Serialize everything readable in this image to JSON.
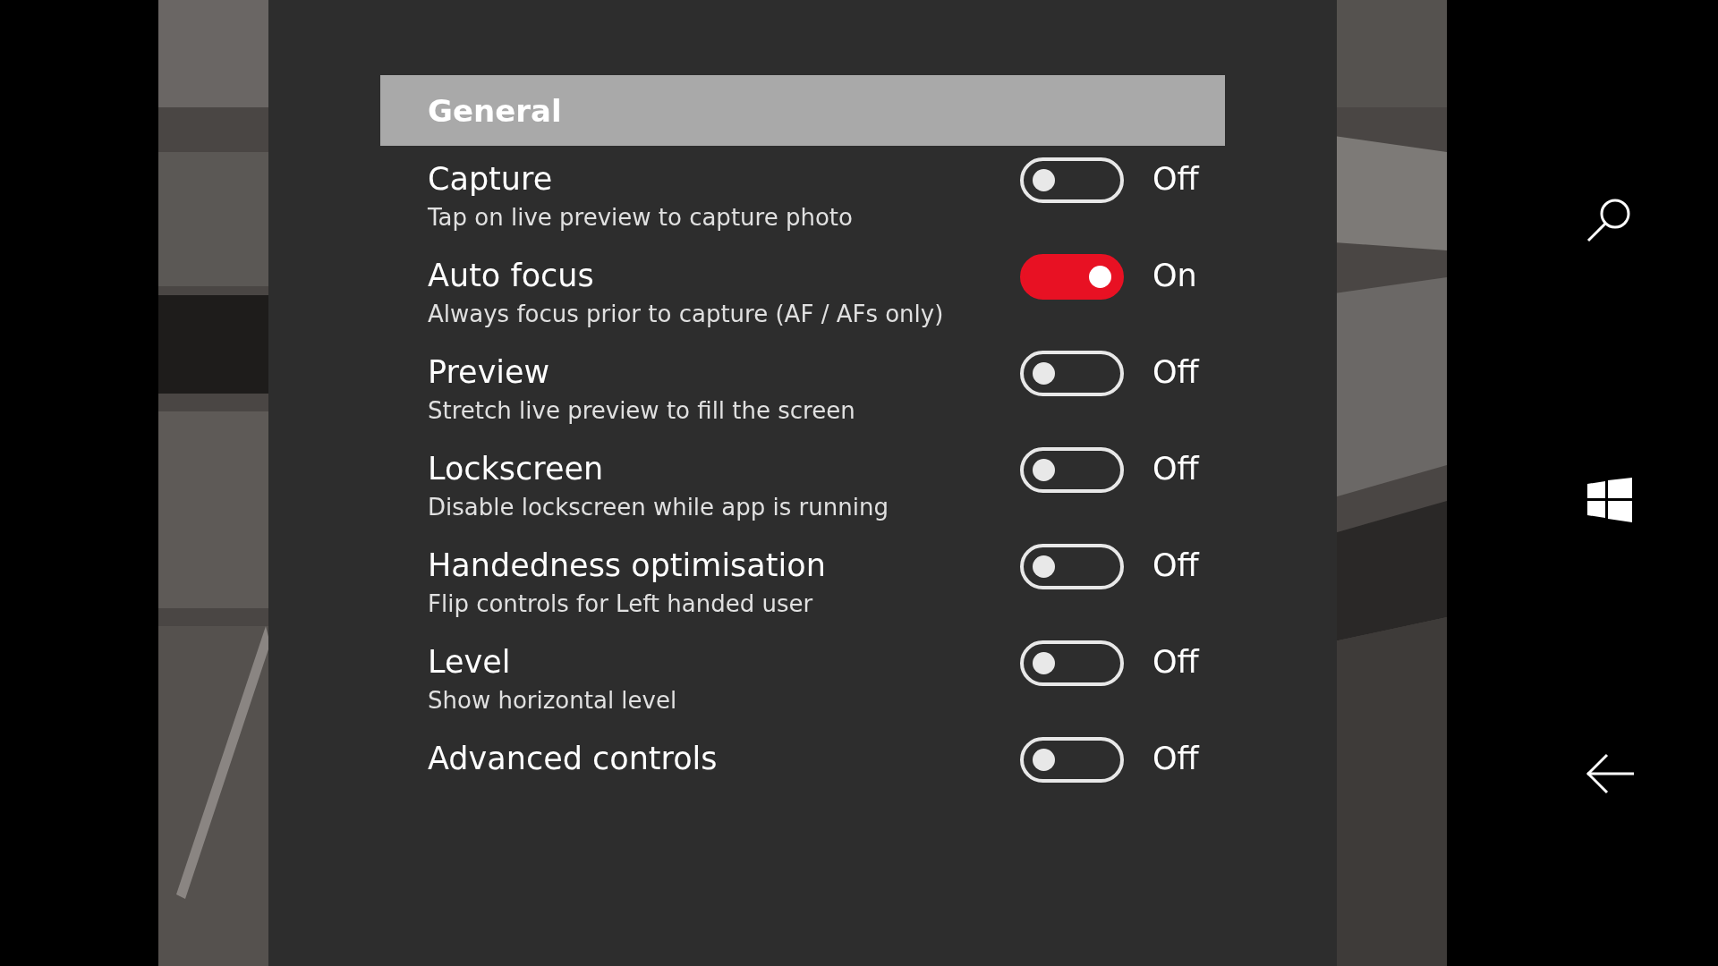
{
  "section": {
    "title": "General"
  },
  "settings": [
    {
      "title": "Capture",
      "description": "Tap on live preview to capture photo",
      "on": false,
      "state_label": "Off"
    },
    {
      "title": "Auto focus",
      "description": "Always focus prior to capture (AF / AFs only)",
      "on": true,
      "state_label": "On"
    },
    {
      "title": "Preview",
      "description": "Stretch live preview to fill the screen",
      "on": false,
      "state_label": "Off"
    },
    {
      "title": "Lockscreen",
      "description": "Disable lockscreen while app is running",
      "on": false,
      "state_label": "Off"
    },
    {
      "title": "Handedness optimisation",
      "description": "Flip controls for Left handed user",
      "on": false,
      "state_label": "Off"
    },
    {
      "title": "Level",
      "description": "Show horizontal level",
      "on": false,
      "state_label": "Off"
    },
    {
      "title": "Advanced controls",
      "on": false,
      "state_label": "Off"
    }
  ]
}
